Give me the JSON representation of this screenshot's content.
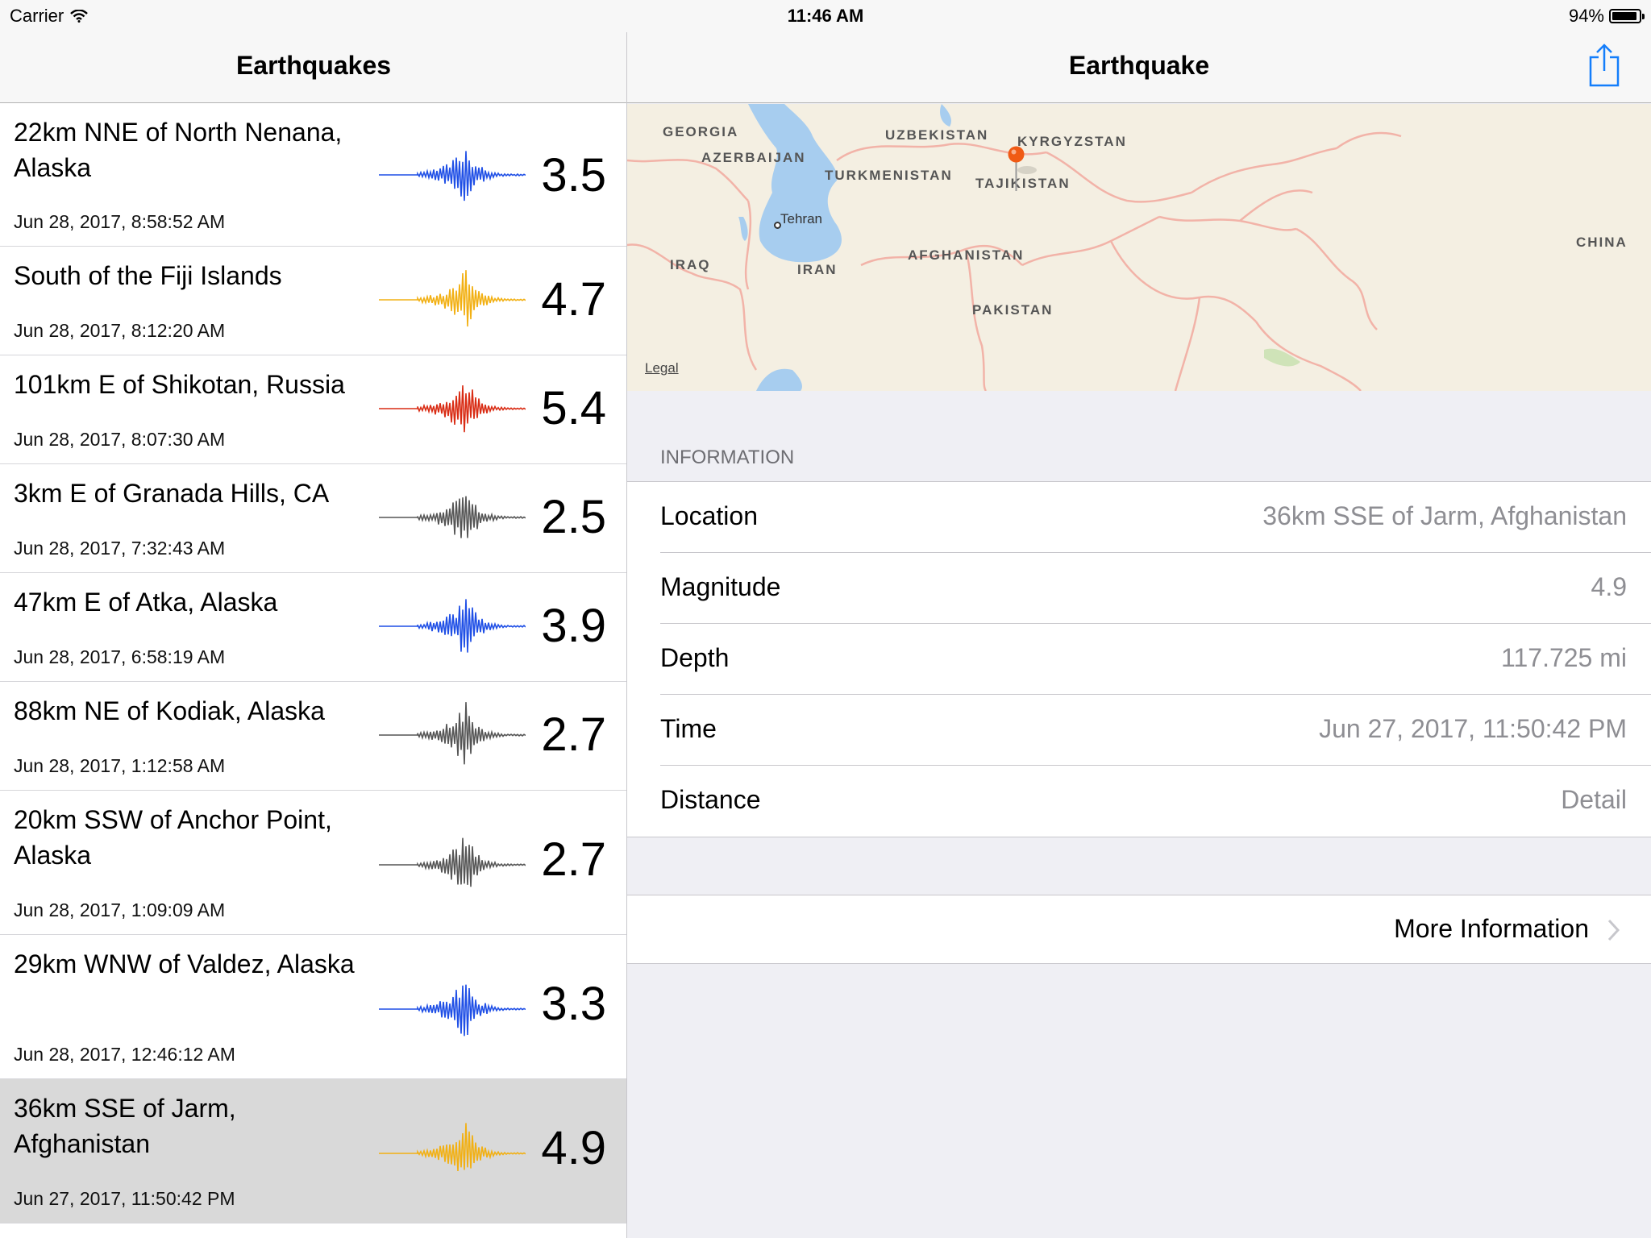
{
  "status_bar": {
    "carrier": "Carrier",
    "time": "11:46 AM",
    "battery": "94%",
    "battery_level": 0.94
  },
  "master": {
    "title": "Earthquakes",
    "quakes": [
      {
        "place": "22km NNE of North Nenana, Alaska",
        "date": "Jun 28, 2017, 8:58:52 AM",
        "magnitude": "3.5",
        "color": "#1f4fe6"
      },
      {
        "place": "South of the Fiji Islands",
        "date": "Jun 28, 2017, 8:12:20 AM",
        "magnitude": "4.7",
        "color": "#f2b013"
      },
      {
        "place": "101km E of Shikotan, Russia",
        "date": "Jun 28, 2017, 8:07:30 AM",
        "magnitude": "5.4",
        "color": "#d92c14"
      },
      {
        "place": "3km E of Granada Hills, CA",
        "date": "Jun 28, 2017, 7:32:43 AM",
        "magnitude": "2.5",
        "color": "#555555"
      },
      {
        "place": "47km E of Atka, Alaska",
        "date": "Jun 28, 2017, 6:58:19 AM",
        "magnitude": "3.9",
        "color": "#1f4fe6"
      },
      {
        "place": "88km NE of Kodiak, Alaska",
        "date": "Jun 28, 2017, 1:12:58 AM",
        "magnitude": "2.7",
        "color": "#555555"
      },
      {
        "place": "20km SSW of Anchor Point, Alaska",
        "date": "Jun 28, 2017, 1:09:09 AM",
        "magnitude": "2.7",
        "color": "#555555"
      },
      {
        "place": "29km WNW of Valdez, Alaska",
        "date": "Jun 28, 2017, 12:46:12 AM",
        "magnitude": "3.3",
        "color": "#1f4fe6"
      },
      {
        "place": "36km SSE of Jarm, Afghanistan",
        "date": "Jun 27, 2017, 11:50:42 PM",
        "magnitude": "4.9",
        "color": "#f2b013",
        "selected": true
      }
    ]
  },
  "detail": {
    "title": "Earthquake",
    "share_icon": "share-icon",
    "map": {
      "countries": [
        "GEORGIA",
        "AZERBAIJAN",
        "UZBEKISTAN",
        "KYRGYZSTAN",
        "TURKMENISTAN",
        "TAJIKISTAN",
        "IRAQ",
        "IRAN",
        "AFGHANISTAN",
        "PAKISTAN",
        "CHINA"
      ],
      "city": "Tehran",
      "legal": "Legal",
      "pin_color": "#f05a14"
    },
    "section_header": "INFORMATION",
    "info": [
      {
        "label": "Location",
        "value": "36km SSE of Jarm, Afghanistan"
      },
      {
        "label": "Magnitude",
        "value": "4.9"
      },
      {
        "label": "Depth",
        "value": "117.725 mi"
      },
      {
        "label": "Time",
        "value": "Jun 27, 2017, 11:50:42 PM"
      },
      {
        "label": "Distance",
        "value": "Detail"
      }
    ],
    "more_info": "More Information"
  }
}
